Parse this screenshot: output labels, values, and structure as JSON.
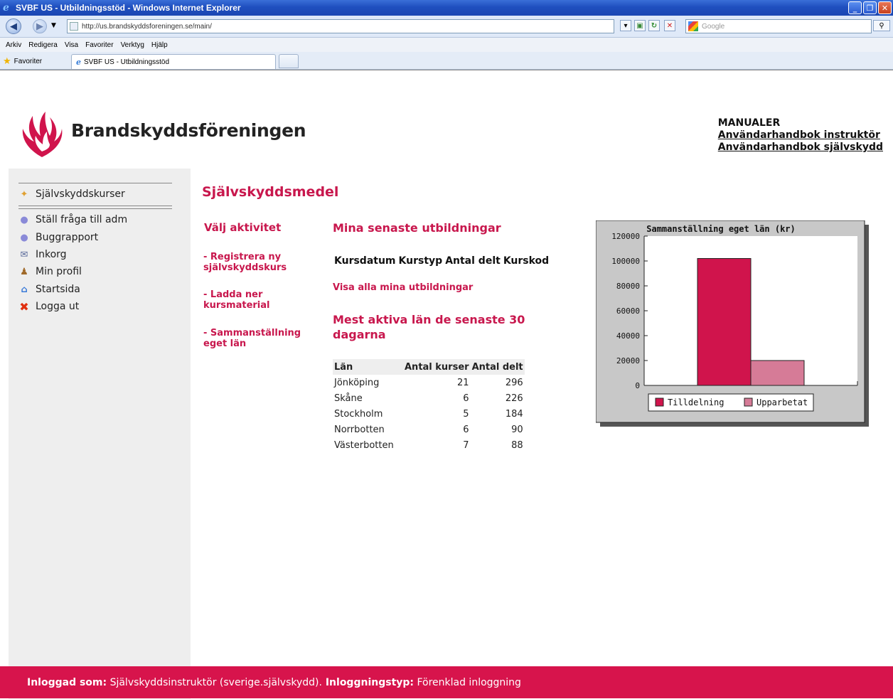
{
  "window": {
    "title": "SVBF US - Utbildningsstöd - Windows Internet Explorer"
  },
  "browser": {
    "url": "http://us.brandskyddsforeningen.se/main/",
    "search_placeholder": "Google",
    "menu": [
      "Arkiv",
      "Redigera",
      "Visa",
      "Favoriter",
      "Verktyg",
      "Hjälp"
    ],
    "favorites_label": "Favoriter",
    "tab_title": "SVBF US - Utbildningsstöd"
  },
  "header": {
    "brand": "Brandskyddsföreningen",
    "manuals_title": "MANUALER",
    "manual_links": [
      "Användarhandbok instruktör",
      "Användarhandbok självskydd"
    ]
  },
  "sidebar": {
    "top_item": "Självskyddskurser",
    "items": [
      "Ställ fråga till adm",
      "Buggrapport",
      "Inkorg",
      "Min profil",
      "Startsida",
      "Logga ut"
    ]
  },
  "main": {
    "page_title": "Självskyddsmedel",
    "activity_title": "Välj aktivitet",
    "activities": [
      "- Registrera ny självskyddskurs",
      "- Ladda ner kursmaterial",
      "- Sammanställning eget län"
    ],
    "recent_title": "Mina senaste utbildningar",
    "recent_headers": [
      "Kursdatum",
      "Kurstyp",
      "Antal delt",
      "Kurskod"
    ],
    "show_all": "Visa alla mina utbildningar",
    "active_title": "Mest aktiva län de senaste 30 dagarna",
    "active_headers": [
      "Län",
      "Antal kurser",
      "Antal delt"
    ],
    "active_rows": [
      [
        "Jönköping",
        "21",
        "296"
      ],
      [
        "Skåne",
        "6",
        "226"
      ],
      [
        "Stockholm",
        "5",
        "184"
      ],
      [
        "Norrbotten",
        "6",
        "90"
      ],
      [
        "Västerbotten",
        "7",
        "88"
      ]
    ]
  },
  "chart_data": {
    "type": "bar",
    "title": "Sammanställning eget län (kr)",
    "xlabel": "",
    "ylabel": "",
    "ylim": [
      0,
      120000
    ],
    "yticks": [
      "0",
      "20000",
      "40000",
      "60000",
      "80000",
      "100000",
      "120000"
    ],
    "series": [
      {
        "name": "Tilldelning",
        "values": [
          102000
        ],
        "color": "#d0144c"
      },
      {
        "name": "Upparbetat",
        "values": [
          20000
        ],
        "color": "#d67b97"
      }
    ],
    "grid": false,
    "legend": "bottom"
  },
  "footer": {
    "logged_label": "Inloggad som:",
    "logged_value": " Självskyddsinstruktör (sverige.självskydd).",
    "type_label": " Inloggningstyp:",
    "type_value": " Förenklad inloggning"
  },
  "colors": {
    "accent": "#c8174d",
    "footer": "#d7144c",
    "sidebar": "#eeeeee"
  }
}
